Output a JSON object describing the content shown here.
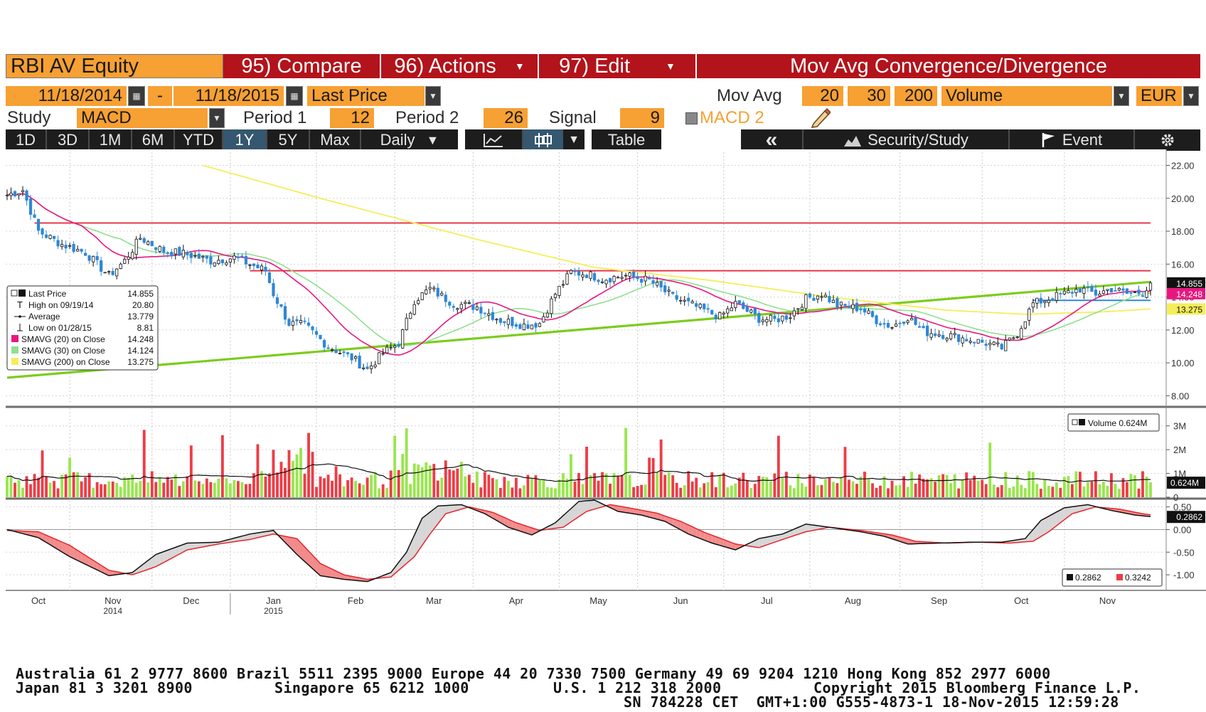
{
  "toolbar": {
    "ticker": "RBI AV Equity",
    "compare_label": "95) Compare",
    "actions_label": "96) Actions",
    "edit_label": "97) Edit",
    "study_title": "Mov Avg Convergence/Divergence",
    "start_date": "11/18/2014",
    "date_sep": "-",
    "end_date": "11/18/2015",
    "price_field": "Last Price",
    "mov_avg_label": "Mov Avg",
    "ma1": "20",
    "ma2": "30",
    "ma3": "200",
    "volume_field": "Volume",
    "currency": "EUR",
    "study_label": "Study",
    "study_value": "MACD",
    "period1_label": "Period 1",
    "period1_value": "12",
    "period2_label": "Period 2",
    "period2_value": "26",
    "signal_label": "Signal",
    "signal_value": "9",
    "macd2_label": "MACD 2",
    "ranges": [
      "1D",
      "3D",
      "1M",
      "6M",
      "YTD",
      "1Y",
      "5Y",
      "Max"
    ],
    "active_range": "1Y",
    "frequency": "Daily",
    "table_label": "Table",
    "back_label": "«",
    "security_study_label": "Security/Study",
    "event_label": "Event"
  },
  "colors": {
    "up": "#99e64d",
    "down": "#ee3c46",
    "price_up": "#2e87d6",
    "sma20": "#e8177f",
    "sma30": "#8fe08f",
    "sma200": "#f5ee5a",
    "trend": "#7ccc1c",
    "resistance": "#e8374a",
    "support": "#2e87d6",
    "tag_black": "#111111",
    "toolbar_red": "#b3131b",
    "toolbar_orange": "#f7a033"
  },
  "chart_data": {
    "type": "candlestick",
    "x_axis": {
      "months": [
        "Oct",
        "Nov",
        "Dec",
        "Jan",
        "Feb",
        "Mar",
        "Apr",
        "May",
        "Jun",
        "Jul",
        "Aug",
        "Sep",
        "Oct",
        "Nov"
      ],
      "years": [
        "2014",
        "2015"
      ]
    },
    "price_panel": {
      "y_ticks": [
        "22.00",
        "20.00",
        "18.00",
        "16.00",
        "14.00",
        "12.00",
        "10.00",
        "8.00"
      ],
      "ylim": [
        7.5,
        22.8
      ],
      "price_anchors": [
        [
          0,
          20.2
        ],
        [
          4,
          20.5
        ],
        [
          8,
          18.0
        ],
        [
          14,
          17.2
        ],
        [
          20,
          16.7
        ],
        [
          26,
          15.3
        ],
        [
          30,
          16.2
        ],
        [
          34,
          17.6
        ],
        [
          40,
          16.8
        ],
        [
          46,
          16.6
        ],
        [
          52,
          16.2
        ],
        [
          58,
          16.4
        ],
        [
          62,
          16.0
        ],
        [
          66,
          15.6
        ],
        [
          68,
          14.2
        ],
        [
          72,
          12.4
        ],
        [
          76,
          12.3
        ],
        [
          82,
          11.0
        ],
        [
          88,
          10.3
        ],
        [
          92,
          9.6
        ],
        [
          96,
          10.6
        ],
        [
          100,
          11.2
        ],
        [
          104,
          13.8
        ],
        [
          108,
          14.5
        ],
        [
          114,
          13.6
        ],
        [
          120,
          13.4
        ],
        [
          126,
          12.6
        ],
        [
          132,
          12.3
        ],
        [
          136,
          12.4
        ],
        [
          140,
          14.2
        ],
        [
          144,
          15.5
        ],
        [
          148,
          15.4
        ],
        [
          152,
          15.1
        ],
        [
          158,
          15.3
        ],
        [
          164,
          15.0
        ],
        [
          170,
          14.0
        ],
        [
          176,
          13.4
        ],
        [
          182,
          12.8
        ],
        [
          186,
          13.6
        ],
        [
          192,
          12.7
        ],
        [
          196,
          12.6
        ],
        [
          200,
          12.9
        ],
        [
          204,
          13.9
        ],
        [
          208,
          14.2
        ],
        [
          212,
          13.5
        ],
        [
          218,
          13.3
        ],
        [
          222,
          12.6
        ],
        [
          226,
          12.2
        ],
        [
          230,
          12.8
        ],
        [
          234,
          11.9
        ],
        [
          240,
          11.7
        ],
        [
          246,
          11.4
        ],
        [
          250,
          11.2
        ],
        [
          254,
          10.9
        ],
        [
          258,
          11.8
        ],
        [
          262,
          13.6
        ],
        [
          266,
          13.9
        ],
        [
          270,
          14.2
        ],
        [
          274,
          14.5
        ],
        [
          278,
          14.2
        ],
        [
          282,
          14.5
        ],
        [
          286,
          14.2
        ],
        [
          290,
          14.3
        ],
        [
          292,
          14.855
        ]
      ],
      "sma200": [
        [
          50,
          22.0
        ],
        [
          80,
          20.0
        ],
        [
          120,
          17.5
        ],
        [
          150,
          15.8
        ],
        [
          180,
          15.0
        ],
        [
          210,
          14.0
        ],
        [
          240,
          13.2
        ],
        [
          260,
          12.95
        ],
        [
          280,
          13.1
        ],
        [
          292,
          13.275
        ]
      ],
      "trend_line": [
        [
          0,
          9.1
        ],
        [
          292,
          14.92
        ]
      ],
      "resistance_1": {
        "level": 18.5,
        "from": 7,
        "to": 292
      },
      "resistance_2": {
        "level": 15.6,
        "from": 62,
        "to": 292
      },
      "support": {
        "level": 13.8,
        "from": 262,
        "to": 292
      },
      "last_tags": [
        {
          "value": "14.855",
          "price": 14.855,
          "color": "#111111"
        },
        {
          "value": "14.248",
          "price": 14.248,
          "color": "#e8177f"
        },
        {
          "value": "13.275",
          "price": 13.275,
          "color": "#f5ee5a"
        }
      ],
      "legend": [
        {
          "label": "Last Price",
          "value": "14.855",
          "marker": "square"
        },
        {
          "label": "High on 09/19/14",
          "value": "20.80",
          "marker": "high"
        },
        {
          "label": "Average",
          "value": "13.779",
          "marker": "avg"
        },
        {
          "label": "Low on 01/28/15",
          "value": "8.81",
          "marker": "low"
        },
        {
          "label": "SMAVG (20) on Close",
          "value": "14.248",
          "marker": "#e8177f"
        },
        {
          "label": "SMAVG (30) on Close",
          "value": "14.124",
          "marker": "#8fe08f"
        },
        {
          "label": "SMAVG (200) on Close",
          "value": "13.275",
          "marker": "#f5ee5a"
        }
      ]
    },
    "volume_panel": {
      "y_ticks": [
        "3M",
        "2M",
        "1M",
        "0"
      ],
      "ylim": [
        0,
        3.5
      ],
      "legend_label": "Volume 0.624M",
      "last_tag": "0.624M",
      "last_value": 0.624
    },
    "macd_panel": {
      "y_ticks": [
        "0.50",
        "0.00",
        "-0.50",
        "-1.00"
      ],
      "ylim": [
        -1.25,
        0.62
      ],
      "macd_anchors": [
        [
          0,
          0.0
        ],
        [
          8,
          -0.18
        ],
        [
          16,
          -0.6
        ],
        [
          26,
          -1.02
        ],
        [
          32,
          -0.95
        ],
        [
          38,
          -0.55
        ],
        [
          46,
          -0.3
        ],
        [
          54,
          -0.28
        ],
        [
          62,
          -0.1
        ],
        [
          68,
          -0.02
        ],
        [
          74,
          -0.55
        ],
        [
          80,
          -1.02
        ],
        [
          86,
          -1.1
        ],
        [
          92,
          -1.15
        ],
        [
          98,
          -0.95
        ],
        [
          102,
          -0.5
        ],
        [
          106,
          0.25
        ],
        [
          110,
          0.52
        ],
        [
          116,
          0.55
        ],
        [
          122,
          0.35
        ],
        [
          128,
          0.05
        ],
        [
          134,
          -0.12
        ],
        [
          140,
          0.15
        ],
        [
          146,
          0.62
        ],
        [
          150,
          0.65
        ],
        [
          156,
          0.4
        ],
        [
          162,
          0.32
        ],
        [
          168,
          0.18
        ],
        [
          174,
          -0.1
        ],
        [
          180,
          -0.3
        ],
        [
          186,
          -0.45
        ],
        [
          192,
          -0.2
        ],
        [
          198,
          -0.1
        ],
        [
          204,
          0.12
        ],
        [
          210,
          0.05
        ],
        [
          218,
          -0.05
        ],
        [
          224,
          -0.15
        ],
        [
          230,
          -0.32
        ],
        [
          238,
          -0.3
        ],
        [
          246,
          -0.28
        ],
        [
          254,
          -0.28
        ],
        [
          260,
          -0.2
        ],
        [
          264,
          0.2
        ],
        [
          270,
          0.48
        ],
        [
          276,
          0.55
        ],
        [
          282,
          0.42
        ],
        [
          288,
          0.32
        ],
        [
          292,
          0.2862
        ]
      ],
      "signal_anchors": [
        [
          0,
          -0.02
        ],
        [
          8,
          -0.05
        ],
        [
          16,
          -0.35
        ],
        [
          26,
          -0.9
        ],
        [
          32,
          -1.0
        ],
        [
          38,
          -0.82
        ],
        [
          46,
          -0.45
        ],
        [
          54,
          -0.32
        ],
        [
          62,
          -0.22
        ],
        [
          68,
          -0.1
        ],
        [
          74,
          -0.2
        ],
        [
          80,
          -0.75
        ],
        [
          86,
          -1.0
        ],
        [
          92,
          -1.1
        ],
        [
          98,
          -1.05
        ],
        [
          104,
          -0.6
        ],
        [
          108,
          -0.1
        ],
        [
          112,
          0.35
        ],
        [
          118,
          0.5
        ],
        [
          124,
          0.38
        ],
        [
          130,
          0.15
        ],
        [
          136,
          -0.02
        ],
        [
          142,
          0.05
        ],
        [
          148,
          0.4
        ],
        [
          154,
          0.55
        ],
        [
          160,
          0.46
        ],
        [
          166,
          0.36
        ],
        [
          172,
          0.18
        ],
        [
          178,
          -0.06
        ],
        [
          186,
          -0.32
        ],
        [
          192,
          -0.4
        ],
        [
          198,
          -0.22
        ],
        [
          204,
          -0.05
        ],
        [
          210,
          0.05
        ],
        [
          218,
          -0.02
        ],
        [
          226,
          -0.12
        ],
        [
          232,
          -0.26
        ],
        [
          240,
          -0.3
        ],
        [
          248,
          -0.28
        ],
        [
          256,
          -0.3
        ],
        [
          262,
          -0.26
        ],
        [
          266,
          -0.05
        ],
        [
          272,
          0.35
        ],
        [
          278,
          0.5
        ],
        [
          284,
          0.45
        ],
        [
          290,
          0.35
        ],
        [
          292,
          0.3242
        ]
      ],
      "legend": [
        {
          "color": "#111111",
          "value": "0.2862"
        },
        {
          "color": "#ee3c46",
          "value": "0.3242"
        }
      ],
      "last_tag": "0.2862",
      "last_value": 0.2862
    }
  },
  "footer": {
    "line1": "Australia 61 2 9777 8600 Brazil 5511 2395 9000 Europe 44 20 7330 7500 Germany 49 69 9204 1210 Hong Kong 852 2977 6000",
    "line2_left": "Japan 81 3 3201 8900",
    "line2_mid1": "Singapore 65 6212 1000",
    "line2_mid2": "U.S. 1 212 318 2000",
    "line2_right": "Copyright 2015 Bloomberg Finance L.P.",
    "line3": "SN 784228 CET  GMT+1:00 G555-4873-1 18-Nov-2015 12:59:28"
  }
}
